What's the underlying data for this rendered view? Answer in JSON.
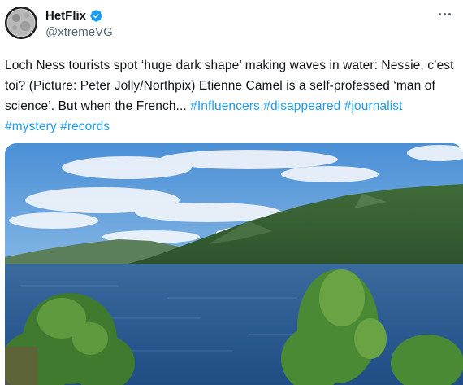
{
  "tweet": {
    "display_name": "HetFlix",
    "handle": "@xtremeVG",
    "body_text": "Loch Ness tourists spot ‘huge dark shape’ making waves in water: Nessie, c’est toi? (Picture: Peter Jolly/Northpix) Etienne Camel is a self-professed ‘man of science’. But when the French... ",
    "hashtags": [
      "#Influencers",
      "#disappeared",
      "#journalist",
      "#mystery",
      "#records"
    ],
    "icons": {
      "avatar": "moon-avatar",
      "verified": "verified-badge-icon",
      "more": "more-options-icon"
    },
    "colors": {
      "link": "#1d9bf0",
      "verified": "#1d9bf0",
      "text": "#0f1419",
      "secondary": "#536471"
    }
  }
}
